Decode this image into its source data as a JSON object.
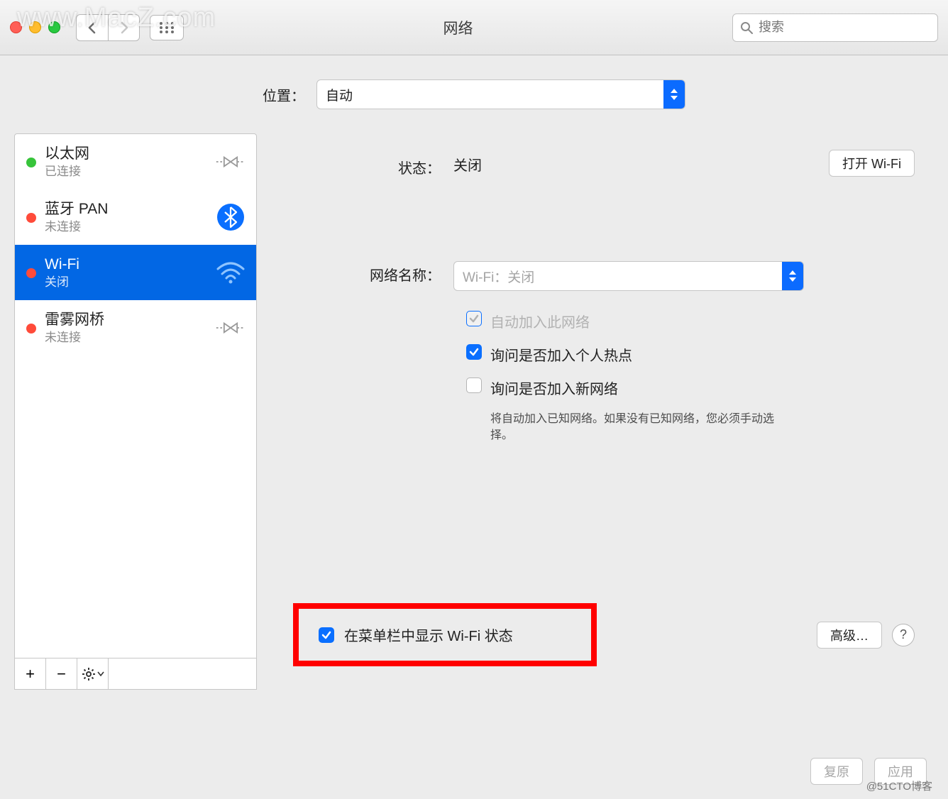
{
  "watermark": "www.MacZ.com",
  "window": {
    "title": "网络"
  },
  "search": {
    "placeholder": "搜索"
  },
  "location": {
    "label": "位置：",
    "value": "自动"
  },
  "sidebar": {
    "items": [
      {
        "name": "以太网",
        "status": "已连接",
        "dot": "green",
        "icon": "ethernet"
      },
      {
        "name": "蓝牙 PAN",
        "status": "未连接",
        "dot": "red",
        "icon": "bluetooth"
      },
      {
        "name": "Wi-Fi",
        "status": "关闭",
        "dot": "red",
        "icon": "wifi",
        "selected": true
      },
      {
        "name": "雷雾网桥",
        "status": "未连接",
        "dot": "red",
        "icon": "ethernet"
      }
    ]
  },
  "detail": {
    "status_label": "状态：",
    "status_value": "关闭",
    "open_wifi": "打开 Wi-Fi",
    "network_name_label": "网络名称：",
    "network_name_value": "Wi-Fi：关闭",
    "auto_join": {
      "label": "自动加入此网络",
      "checked": false,
      "disabled": true
    },
    "ask_hotspot": {
      "label": "询问是否加入个人热点",
      "checked": true
    },
    "ask_new": {
      "label": "询问是否加入新网络",
      "checked": false,
      "desc": "将自动加入已知网络。如果没有已知网络，您必须手动选择。"
    },
    "show_menubar": {
      "label": "在菜单栏中显示 Wi-Fi 状态",
      "checked": true
    },
    "advanced": "高级…"
  },
  "bottom": {
    "revert": "复原",
    "apply": "应用"
  },
  "credit": "@51CTO博客"
}
